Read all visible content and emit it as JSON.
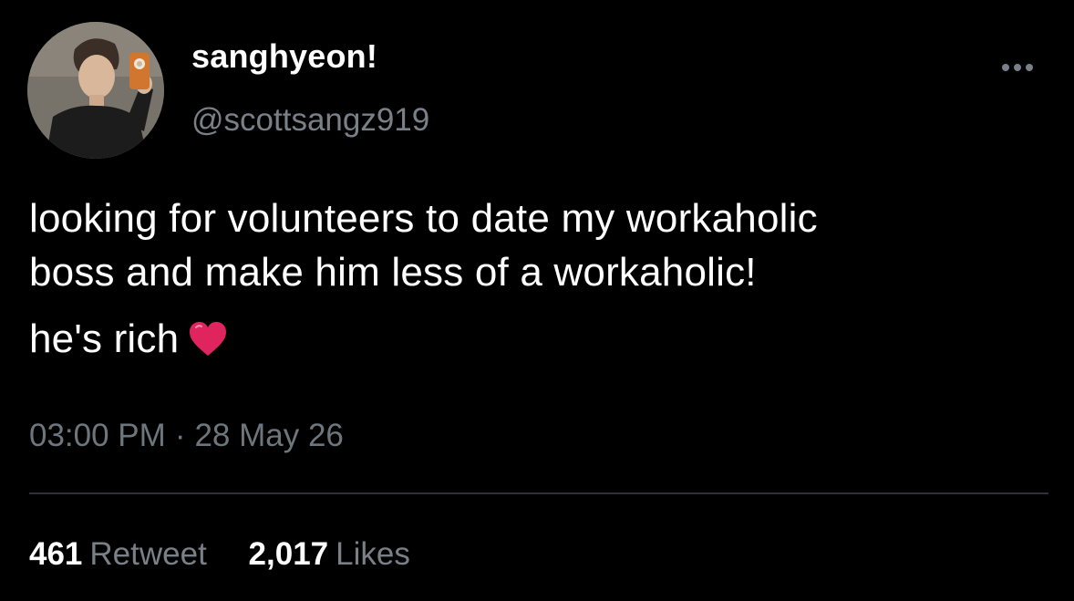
{
  "author": {
    "display_name": "sanghyeon!",
    "handle": "@scottsangz919"
  },
  "tweet": {
    "lines": [
      "looking for volunteers to date my workaholic",
      "boss and make him less of a workaholic!",
      "he's rich"
    ],
    "emoji": "red-heart-icon"
  },
  "meta": {
    "time": "03:00 PM",
    "separator": "·",
    "date": "28 May 26"
  },
  "stats": {
    "retweets_count": "461",
    "retweets_label": "Retweet",
    "likes_count": "2,017",
    "likes_label": "Likes"
  },
  "colors": {
    "background": "#000000",
    "primary_text": "#ffffff",
    "secondary_text": "#6e767d",
    "divider": "#2f3336",
    "heart": "#e0245e"
  }
}
